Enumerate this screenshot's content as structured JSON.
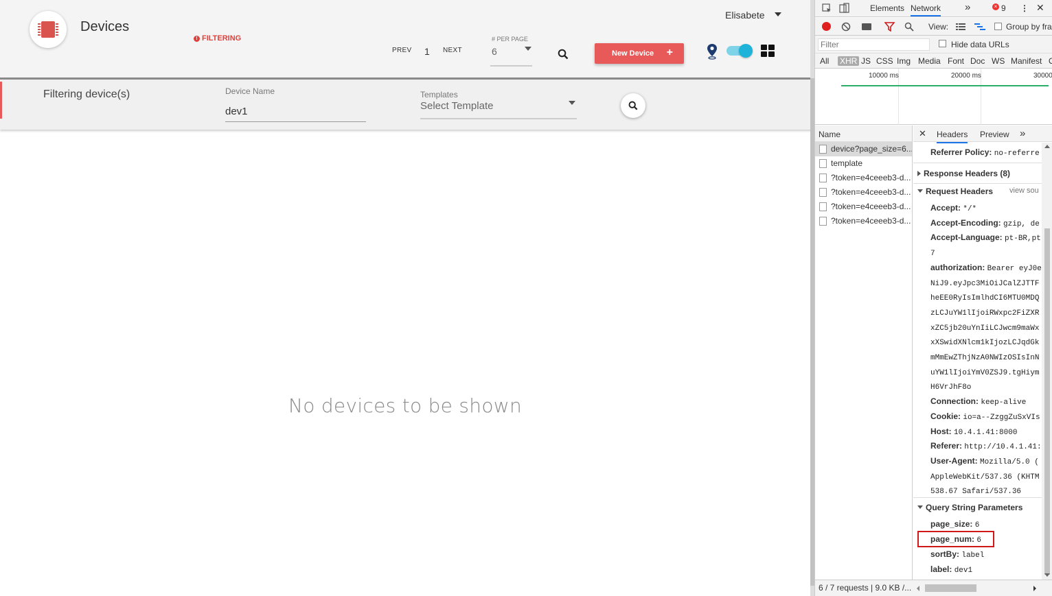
{
  "app": {
    "title": "Devices",
    "filtering_badge": "FILTERING",
    "user": "Elisabete",
    "pager": {
      "prev": "PREV",
      "page": "1",
      "next": "NEXT"
    },
    "per_page": {
      "label": "# PER PAGE",
      "value": "6"
    },
    "new_device_label": "New Device",
    "filter_bar": {
      "title": "Filtering device(s)",
      "device_name_label": "Device Name",
      "device_name_value": "dev1",
      "templates_label": "Templates",
      "templates_value": "Select Template"
    },
    "empty_message": "No devices to be shown",
    "colors": {
      "accent": "#e85a5a",
      "toggle": "#1fb3d9"
    }
  },
  "devtools": {
    "tabs": [
      "Elements",
      "Network"
    ],
    "error_count": "9",
    "toolbar": {
      "view_label": "View:",
      "group_label": "Group by fra"
    },
    "filter_placeholder": "Filter",
    "hide_data_urls": "Hide data URLs",
    "types": [
      "All",
      "XHR",
      "JS",
      "CSS",
      "Img",
      "Media",
      "Font",
      "Doc",
      "WS",
      "Manifest",
      "O"
    ],
    "timeline_labels": [
      "10000 ms",
      "20000 ms",
      "30000"
    ],
    "name_header": "Name",
    "requests": [
      "device?page_size=6...",
      "template",
      "?token=e4ceeeb3-d...",
      "?token=e4ceeeb3-d...",
      "?token=e4ceeeb3-d...",
      "?token=e4ceeeb3-d..."
    ],
    "detail_tabs": [
      "Headers",
      "Preview"
    ],
    "referrer_policy": {
      "k": "Referrer Policy:",
      "v": "no-referre"
    },
    "response_headers": "Response Headers (8)",
    "request_headers": "Request Headers",
    "view_source": "view sou",
    "headers": [
      {
        "k": "Accept:",
        "v": "*/*"
      },
      {
        "k": "Accept-Encoding:",
        "v": "gzip, de"
      },
      {
        "k": "Accept-Language:",
        "v": "pt-BR,pt"
      },
      {
        "k": "",
        "v": "7"
      },
      {
        "k": "authorization:",
        "v": "Bearer eyJ0e"
      },
      {
        "k": "",
        "v": "NiJ9.eyJpc3MiOiJCalZJTTF"
      },
      {
        "k": "",
        "v": "heEE0RyIsImlhdCI6MTU0MDQ"
      },
      {
        "k": "",
        "v": "zLCJuYW1lIjoiRWxpc2FiZXR"
      },
      {
        "k": "",
        "v": "xZC5jb20uYnIiLCJwcm9maWx"
      },
      {
        "k": "",
        "v": "xXSwidXNlcm1kIjozLCJqdGk"
      },
      {
        "k": "",
        "v": "mMmEwZThjNzA0NWIzOSIsInN"
      },
      {
        "k": "",
        "v": "uYW1lIjoiYmV0ZSJ9.tgHiym"
      },
      {
        "k": "",
        "v": "H6VrJhF8o"
      },
      {
        "k": "Connection:",
        "v": "keep-alive"
      },
      {
        "k": "Cookie:",
        "v": "io=a--ZzggZuSxVIs"
      },
      {
        "k": "Host:",
        "v": "10.4.1.41:8000"
      },
      {
        "k": "Referer:",
        "v": "http://10.4.1.41:"
      },
      {
        "k": "User-Agent:",
        "v": "Mozilla/5.0 ("
      },
      {
        "k": "",
        "v": "AppleWebKit/537.36 (KHTM"
      },
      {
        "k": "",
        "v": "538.67 Safari/537.36"
      }
    ],
    "query_string": "Query String Parameters",
    "query_params": [
      {
        "k": "page_size:",
        "v": "6"
      },
      {
        "k": "page_num:",
        "v": "6"
      },
      {
        "k": "sortBy:",
        "v": "label"
      },
      {
        "k": "label:",
        "v": "dev1"
      }
    ],
    "status": "6 / 7 requests  |  9.0 KB /..."
  }
}
